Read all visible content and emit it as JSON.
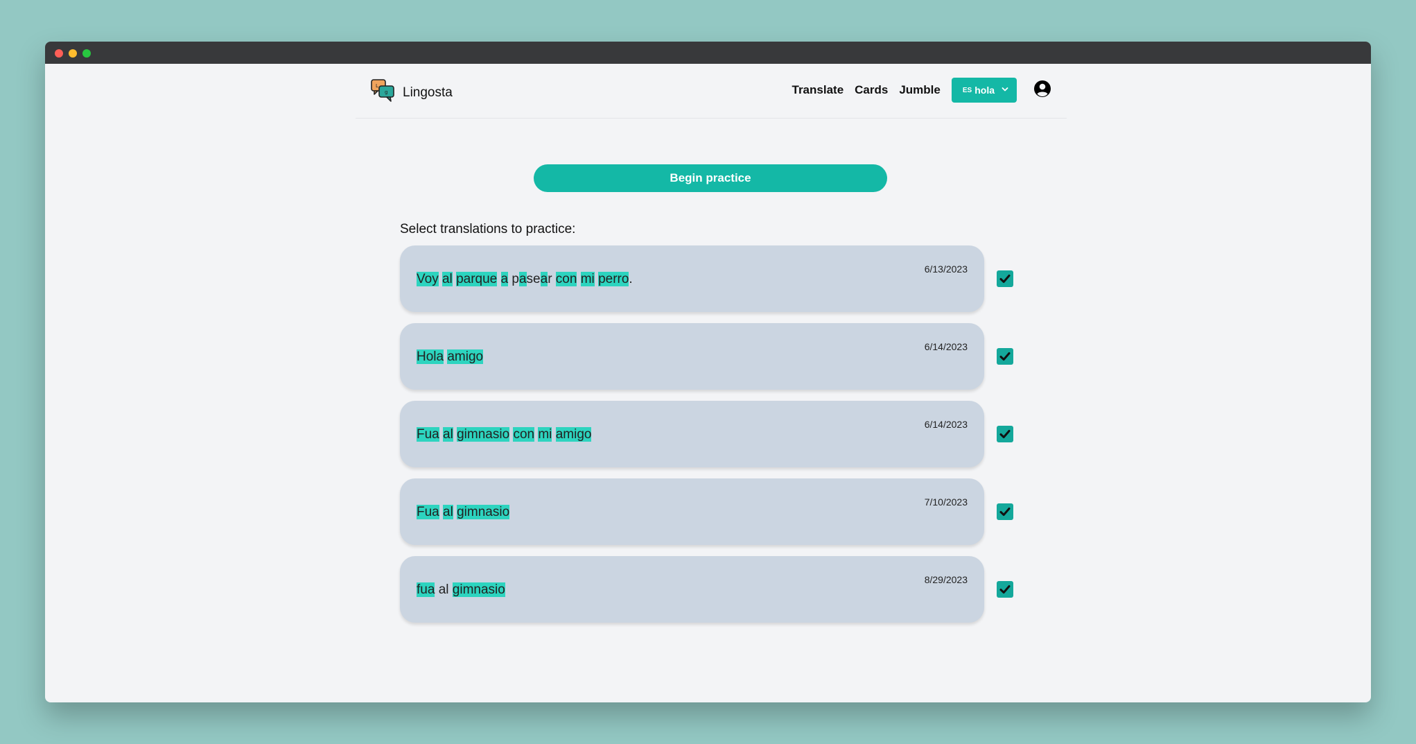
{
  "app": {
    "name": "Lingosta"
  },
  "nav": {
    "links": [
      "Translate",
      "Cards",
      "Jumble"
    ],
    "language": {
      "code": "ES",
      "word": "hola"
    }
  },
  "main": {
    "begin_label": "Begin practice",
    "select_label": "Select translations to practice:",
    "cards": [
      {
        "date": "6/13/2023",
        "checked": true,
        "segments": [
          {
            "t": "Voy",
            "hl": true
          },
          {
            "t": " ",
            "hl": false
          },
          {
            "t": "al",
            "hl": true
          },
          {
            "t": " ",
            "hl": false
          },
          {
            "t": "parque",
            "hl": true
          },
          {
            "t": " ",
            "hl": false
          },
          {
            "t": "a",
            "hl": true
          },
          {
            "t": " p",
            "hl": false
          },
          {
            "t": "a",
            "hl": true
          },
          {
            "t": "se",
            "hl": false
          },
          {
            "t": "a",
            "hl": true
          },
          {
            "t": "r ",
            "hl": false
          },
          {
            "t": "con",
            "hl": true
          },
          {
            "t": " ",
            "hl": false
          },
          {
            "t": "mi",
            "hl": true
          },
          {
            "t": " ",
            "hl": false
          },
          {
            "t": "perro",
            "hl": true
          },
          {
            "t": ".",
            "hl": false
          }
        ]
      },
      {
        "date": "6/14/2023",
        "checked": true,
        "segments": [
          {
            "t": "Hola",
            "hl": true
          },
          {
            "t": " ",
            "hl": false
          },
          {
            "t": "amigo",
            "hl": true
          }
        ]
      },
      {
        "date": "6/14/2023",
        "checked": true,
        "segments": [
          {
            "t": "Fua",
            "hl": true
          },
          {
            "t": " ",
            "hl": false
          },
          {
            "t": "al",
            "hl": true
          },
          {
            "t": " ",
            "hl": false
          },
          {
            "t": "gimnasio",
            "hl": true
          },
          {
            "t": " ",
            "hl": false
          },
          {
            "t": "con",
            "hl": true
          },
          {
            "t": " ",
            "hl": false
          },
          {
            "t": "mi",
            "hl": true
          },
          {
            "t": " ",
            "hl": false
          },
          {
            "t": "amigo",
            "hl": true
          }
        ]
      },
      {
        "date": "7/10/2023",
        "checked": true,
        "segments": [
          {
            "t": "Fua",
            "hl": true
          },
          {
            "t": " ",
            "hl": false
          },
          {
            "t": "al",
            "hl": true
          },
          {
            "t": " ",
            "hl": false
          },
          {
            "t": "gimnasio",
            "hl": true
          }
        ]
      },
      {
        "date": "8/29/2023",
        "checked": true,
        "segments": [
          {
            "t": "fua",
            "hl": true
          },
          {
            "t": " al ",
            "hl": false
          },
          {
            "t": "gimnasio",
            "hl": true
          }
        ]
      }
    ]
  },
  "colors": {
    "accent": "#14b8a6",
    "highlight": "#2dd4bf",
    "card": "#cbd5e1",
    "outer_bg": "#93c8c3"
  },
  "icons": [
    "speech-bubbles-logo-icon",
    "chevron-down-icon",
    "user-circle-icon",
    "checkmark-icon"
  ]
}
